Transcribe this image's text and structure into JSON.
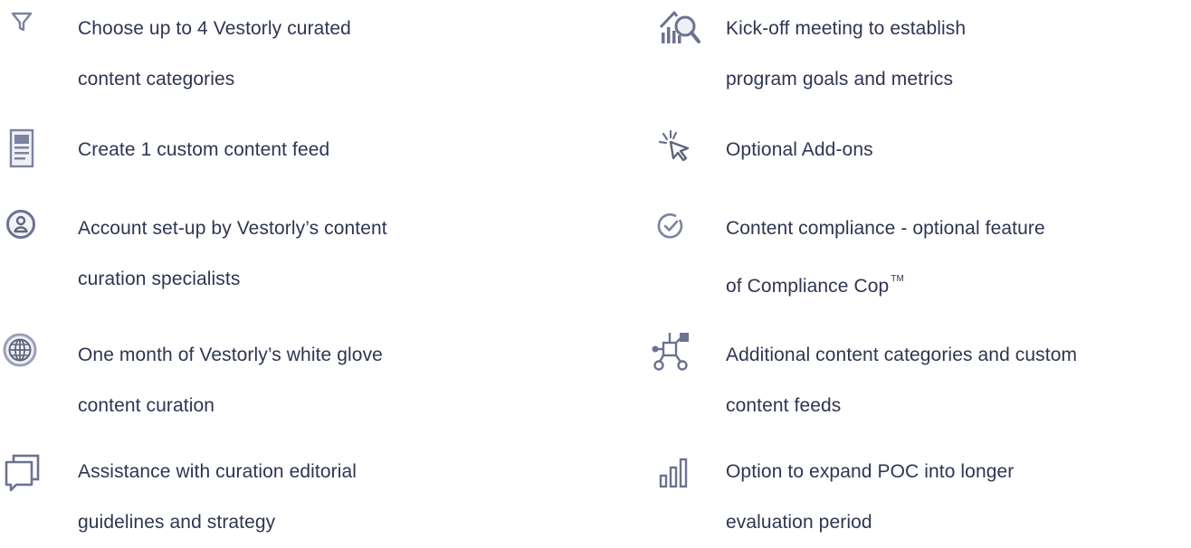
{
  "colors": {
    "text": "#2f3552",
    "icon_gray": "#8a90a8",
    "icon_dark": "#5f667d",
    "icon_light": "#c9ccda",
    "background": "#ffffff"
  },
  "left_items": [
    {
      "icon": "funnel-icon",
      "line1": "Choose up to 4 Vestorly curated",
      "line2": "content categories"
    },
    {
      "icon": "newspaper-icon",
      "line1": "Create 1 custom content feed",
      "line2": ""
    },
    {
      "icon": "user-circle-icon",
      "line1": "Account set-up by Vestorly’s content",
      "line2": "curation specialists"
    },
    {
      "icon": "globe-icon",
      "line1": "One month of Vestorly’s white glove",
      "line2": "content curation"
    },
    {
      "icon": "chat-bubble-icon",
      "line1": "Assistance with curation editorial",
      "line2": "guidelines and strategy"
    }
  ],
  "right_items": [
    {
      "icon": "analytics-magnifier-icon",
      "line1": "Kick-off meeting to establish",
      "line2": "program goals and metrics"
    },
    {
      "icon": "cursor-click-icon",
      "line1": "Optional Add-ons",
      "line2": ""
    },
    {
      "icon": "check-circle-icon",
      "line1": "Content compliance - optional feature",
      "line2": "of Compliance Cop",
      "trademark": "TM"
    },
    {
      "icon": "network-nodes-icon",
      "line1": "Additional content categories and custom",
      "line2": "content feeds"
    },
    {
      "icon": "bar-chart-icon",
      "line1": "Option to expand POC into longer",
      "line2": "evaluation period"
    }
  ]
}
